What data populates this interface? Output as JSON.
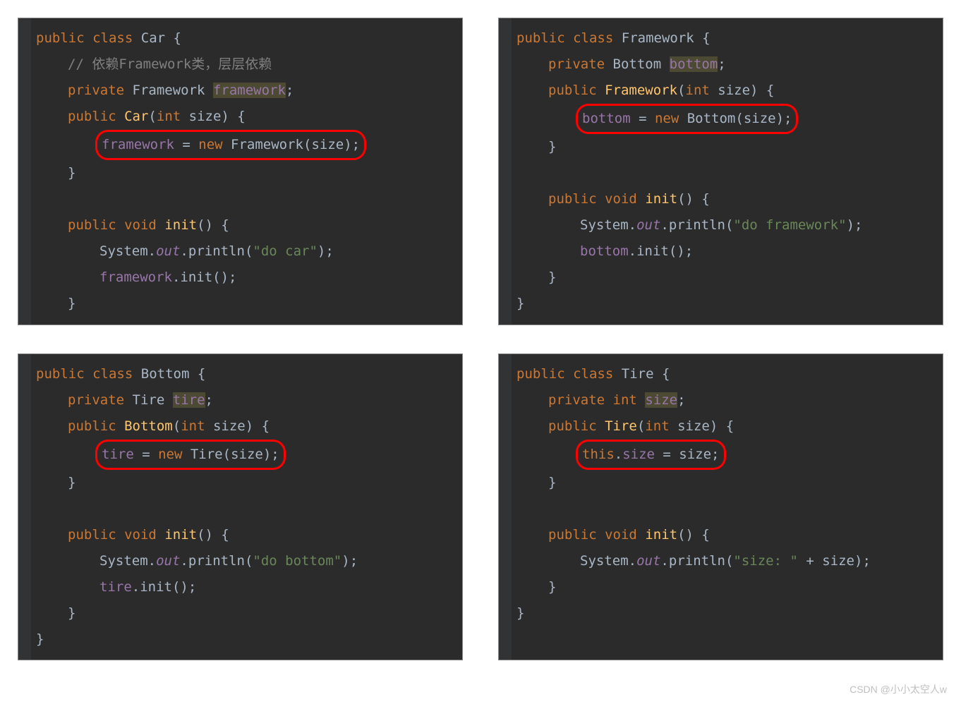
{
  "blocks": {
    "car": {
      "decl": {
        "kw1": "public",
        "kw2": "class",
        "name": "Car",
        "brace": " {"
      },
      "comment": "// 依赖Framework类，层层依赖",
      "field": {
        "kw": "private",
        "type": "Framework",
        "name": "framework",
        "semi": ";"
      },
      "ctor": {
        "kw": "public",
        "name": "Car",
        "open": "(",
        "ptype": "int",
        "pname": "size",
        "close": ") {"
      },
      "ctorBody": {
        "lhs": "framework",
        "eq": " = ",
        "kwNew": "new",
        "call": " Framework",
        "args": "(size);"
      },
      "closeBrace": "}",
      "init": {
        "kw1": "public",
        "kw2": "void",
        "name": "init",
        "close": "() {"
      },
      "print": {
        "sys": "System",
        "dot": ".",
        "out": "out",
        "dot2": ".",
        "pln": "println",
        "arg": "(",
        "str": "\"do car\"",
        "end": ");"
      },
      "call": {
        "obj": "framework",
        "dot": ".",
        "m": "init",
        "end": "();"
      }
    },
    "framework": {
      "decl": {
        "kw1": "public",
        "kw2": "class",
        "name": "Framework",
        "brace": " {"
      },
      "field": {
        "kw": "private",
        "type": "Bottom",
        "name": "bottom",
        "semi": ";"
      },
      "ctor": {
        "kw": "public",
        "name": "Framework",
        "open": "(",
        "ptype": "int",
        "pname": "size",
        "close": ") {"
      },
      "ctorBody": {
        "lhs": "bottom",
        "eq": " = ",
        "kwNew": "new",
        "call": " Bottom",
        "args": "(size);"
      },
      "closeBrace": "}",
      "init": {
        "kw1": "public",
        "kw2": "void",
        "name": "init",
        "close": "() {"
      },
      "print": {
        "sys": "System",
        "dot": ".",
        "out": "out",
        "dot2": ".",
        "pln": "println",
        "arg": "(",
        "str": "\"do framework\"",
        "end": ");"
      },
      "call": {
        "obj": "bottom",
        "dot": ".",
        "m": "init",
        "end": "();"
      }
    },
    "bottom": {
      "decl": {
        "kw1": "public",
        "kw2": "class",
        "name": "Bottom",
        "brace": " {"
      },
      "field": {
        "kw": "private",
        "type": "Tire",
        "name": "tire",
        "semi": ";"
      },
      "ctor": {
        "kw": "public",
        "name": "Bottom",
        "open": "(",
        "ptype": "int",
        "pname": "size",
        "close": ") {"
      },
      "ctorBody": {
        "lhs": "tire",
        "eq": " = ",
        "kwNew": "new",
        "call": " Tire",
        "args": "(size);"
      },
      "closeBrace": "}",
      "init": {
        "kw1": "public",
        "kw2": "void",
        "name": "init",
        "close": "() {"
      },
      "print": {
        "sys": "System",
        "dot": ".",
        "out": "out",
        "dot2": ".",
        "pln": "println",
        "arg": "(",
        "str": "\"do bottom\"",
        "end": ");"
      },
      "call": {
        "obj": "tire",
        "dot": ".",
        "m": "init",
        "end": "();"
      }
    },
    "tire": {
      "decl": {
        "kw1": "public",
        "kw2": "class",
        "name": "Tire",
        "brace": " {"
      },
      "field": {
        "kw": "private",
        "type": "int",
        "name": "size",
        "semi": ";"
      },
      "ctor": {
        "kw": "public",
        "name": "Tire",
        "open": "(",
        "ptype": "int",
        "pname": "size",
        "close": ") {"
      },
      "ctorBody": {
        "kwThis": "this",
        "dot": ".",
        "lhs": "size",
        "eq": " = size;"
      },
      "closeBrace": "}",
      "init": {
        "kw1": "public",
        "kw2": "void",
        "name": "init",
        "close": "() {"
      },
      "print": {
        "sys": "System",
        "dot": ".",
        "out": "out",
        "dot2": ".",
        "pln": "println",
        "arg": "(",
        "str": "\"size: \"",
        "plus": " + size",
        "end": ");"
      }
    }
  },
  "watermark": "CSDN @小小太空人w"
}
